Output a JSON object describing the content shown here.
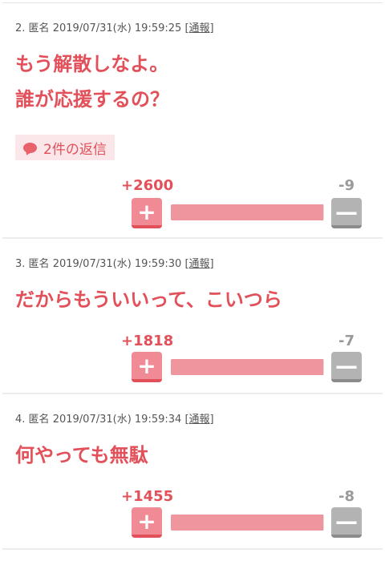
{
  "colors": {
    "accent": "#e2505a",
    "plus_button": "#f08a95",
    "minus_button": "#b3b3b3",
    "bar_fill": "#ef959e"
  },
  "comments": [
    {
      "number": "2.",
      "name": "匿名",
      "datetime": "2019/07/31(水) 19:59:25",
      "report_open": "[",
      "report_label": "通報",
      "report_close": "]",
      "body_lines": [
        "もう解散しなよ。",
        "誰が応援するの？"
      ],
      "replies_label": "2件の返信",
      "plus_count": "+2600",
      "minus_count": "-9",
      "plus_button": "+",
      "minus_button": "—",
      "plus_ratio": 0.9966
    },
    {
      "number": "3.",
      "name": "匿名",
      "datetime": "2019/07/31(水) 19:59:30",
      "report_open": "[",
      "report_label": "通報",
      "report_close": "]",
      "body_lines": [
        "だからもういいって、こいつら"
      ],
      "plus_count": "+1818",
      "minus_count": "-7",
      "plus_button": "+",
      "minus_button": "—",
      "plus_ratio": 0.9962
    },
    {
      "number": "4.",
      "name": "匿名",
      "datetime": "2019/07/31(水) 19:59:34",
      "report_open": "[",
      "report_label": "通報",
      "report_close": "]",
      "body_lines": [
        "何やっても無駄"
      ],
      "plus_count": "+1455",
      "minus_count": "-8",
      "plus_button": "+",
      "minus_button": "—",
      "plus_ratio": 0.9945
    }
  ]
}
